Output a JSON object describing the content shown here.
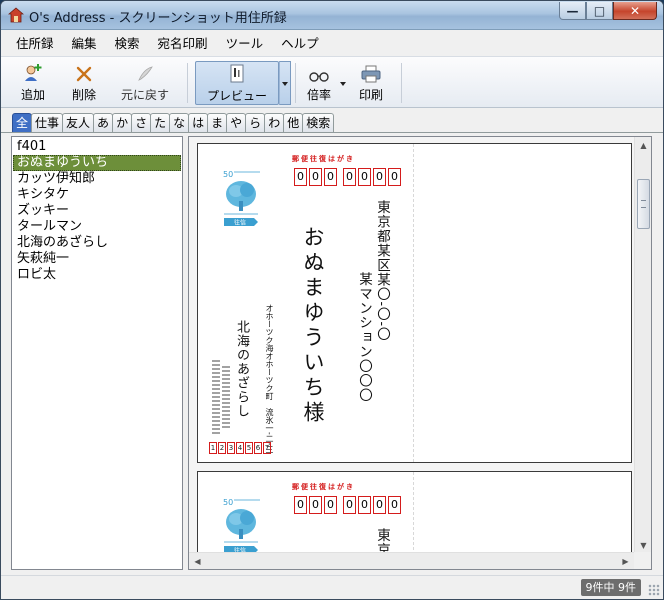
{
  "window": {
    "title": "O's Address - スクリーンショット用住所録",
    "buttons": {
      "minimize": "—",
      "maximize": "□",
      "close": "✕"
    }
  },
  "menu": [
    "住所録",
    "編集",
    "検索",
    "宛名印刷",
    "ツール",
    "ヘルプ"
  ],
  "toolbar": {
    "add": "追加",
    "delete": "削除",
    "undo": "元に戻す",
    "preview": "プレビュー",
    "zoom": "倍率",
    "print": "印刷"
  },
  "tabs": [
    "全",
    "仕事",
    "友人",
    "あ",
    "か",
    "さ",
    "た",
    "な",
    "は",
    "ま",
    "や",
    "ら",
    "わ",
    "他",
    "検索"
  ],
  "contacts": [
    "f401",
    "おぬまゆういち",
    "カッツ伊知郎",
    "キシタケ",
    "ズッキー",
    "タールマン",
    "北海のあざらし",
    "矢萩純一",
    "ロビ太"
  ],
  "selected_index": 1,
  "postcard": {
    "header": "郵便往復はがき",
    "zip_digits": [
      "0",
      "0",
      "0",
      "0",
      "0",
      "0",
      "0"
    ],
    "address_line1": "東京都某区某〇-〇-〇",
    "address_line2": "某マンション〇〇〇",
    "recipient": "おぬまゆういち様",
    "sender_address": "オホーツク海オホーツク町　流氷一-二-三",
    "sender_name": "北海のあざらし",
    "sender_zip": [
      "1",
      "2",
      "3",
      "4",
      "5",
      "6",
      "7"
    ],
    "stamp_value": "50",
    "stamp_label": "往信"
  },
  "postcard2": {
    "header": "郵便往復はがき",
    "zip_digits": [
      "0",
      "0",
      "0",
      "0",
      "0",
      "0",
      "0"
    ],
    "address_partial": "東京",
    "stamp_value": "50",
    "stamp_label": "往信"
  },
  "status": {
    "count": "9件中 9件"
  },
  "colors": {
    "selection": "#6d8f3a",
    "active_tab": "#3f6fc5",
    "postal_red": "#d41c1c",
    "stamp_blue": "#3a9fd0"
  }
}
